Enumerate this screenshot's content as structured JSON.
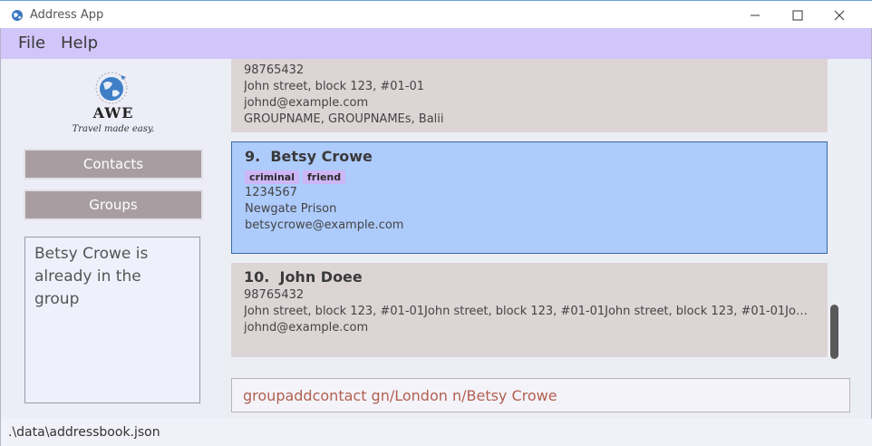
{
  "window": {
    "title": "Address App"
  },
  "menu": {
    "items": [
      "File",
      "Help"
    ]
  },
  "sidebar": {
    "logo": {
      "brand": "AWE",
      "tagline": "Travel made easy."
    },
    "buttons": {
      "contacts": "Contacts",
      "groups": "Groups"
    },
    "result_message": "Betsy Crowe is already in the group"
  },
  "contacts": [
    {
      "index": "",
      "name": "",
      "tags": [],
      "phone": "98765432",
      "address": "John street, block 123, #01-01",
      "email": "johnd@example.com",
      "groups": "GROUPNAME, GROUPNAMEs, Balii",
      "selected": false
    },
    {
      "index": "9.",
      "name": "Betsy Crowe",
      "tags": [
        "criminal",
        "friend"
      ],
      "phone": "1234567",
      "address": "Newgate Prison",
      "email": "betsycrowe@example.com",
      "selected": true
    },
    {
      "index": "10.",
      "name": "John Doee",
      "tags": [],
      "phone": "98765432",
      "address": "John street, block 123, #01-01John street, block 123, #01-01John street, block 123, #01-01John street, bl...",
      "email": "johnd@example.com",
      "selected": false
    }
  ],
  "command_input": {
    "value": "groupaddcontact gn/London n/Betsy Crowe"
  },
  "status_bar": {
    "path": ".\\data\\addressbook.json"
  },
  "colors": {
    "menubar": "#d1c6f9",
    "card": "#ddd4d5",
    "card_selected": "#adcbfb",
    "tag": "#cdb6f5",
    "side_button": "#a89ea1",
    "command_text": "#b2604f"
  },
  "icons": [
    "app-globe-icon",
    "minimize-icon",
    "maximize-icon",
    "close-icon",
    "globe-logo-icon"
  ]
}
